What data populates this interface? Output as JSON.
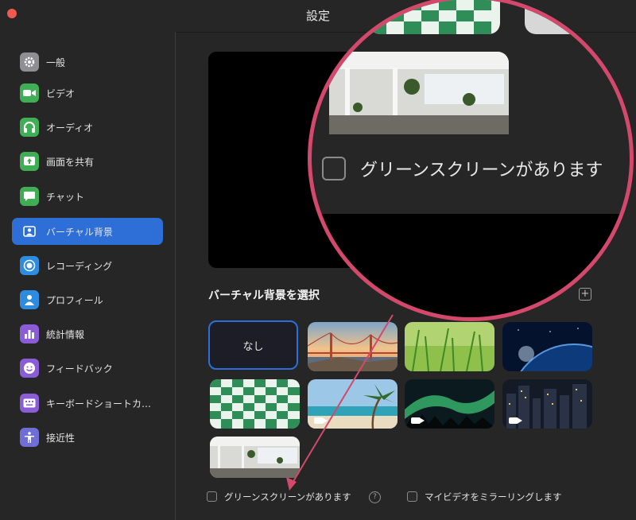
{
  "window": {
    "title": "設定"
  },
  "sidebar": {
    "items": [
      {
        "label": "一般",
        "icon": "gear-icon",
        "color": "#8e8e93"
      },
      {
        "label": "ビデオ",
        "icon": "video-camera-icon",
        "color": "#3fae55"
      },
      {
        "label": "オーディオ",
        "icon": "headphones-icon",
        "color": "#3fae55"
      },
      {
        "label": "画面を共有",
        "icon": "share-screen-icon",
        "color": "#3fae55"
      },
      {
        "label": "チャット",
        "icon": "chat-bubble-icon",
        "color": "#3fae55"
      },
      {
        "label": "バーチャル背景",
        "icon": "person-background-icon",
        "color": "#2d6fd6",
        "active": true
      },
      {
        "label": "レコーディング",
        "icon": "record-icon",
        "color": "#2d8ce0"
      },
      {
        "label": "プロフィール",
        "icon": "person-icon",
        "color": "#2d8ce0"
      },
      {
        "label": "統計情報",
        "icon": "bar-chart-icon",
        "color": "#8a5cd6"
      },
      {
        "label": "フィードバック",
        "icon": "smiley-icon",
        "color": "#8a5cd6"
      },
      {
        "label": "キーボードショートカ…",
        "icon": "keyboard-icon",
        "color": "#8a5cd6"
      },
      {
        "label": "接近性",
        "icon": "accessibility-icon",
        "color": "#6e6ed6"
      }
    ]
  },
  "main": {
    "section_title": "バーチャル背景を選択",
    "none_label": "なし",
    "thumbnails": [
      {
        "name": "none"
      },
      {
        "name": "golden-gate-bridge"
      },
      {
        "name": "grass"
      },
      {
        "name": "earth-from-space"
      },
      {
        "name": "jbug-pattern"
      },
      {
        "name": "beach-palm",
        "video": true
      },
      {
        "name": "aurora",
        "video": true
      },
      {
        "name": "city-night",
        "video": true
      },
      {
        "name": "office"
      }
    ],
    "green_screen_label": "グリーンスクリーンがあります",
    "help_symbol": "?",
    "mirror_label": "マイビデオをミラーリングします"
  },
  "magnifier": {
    "label": "グリーンスクリーンがあります",
    "accent_color": "#d4496b"
  }
}
